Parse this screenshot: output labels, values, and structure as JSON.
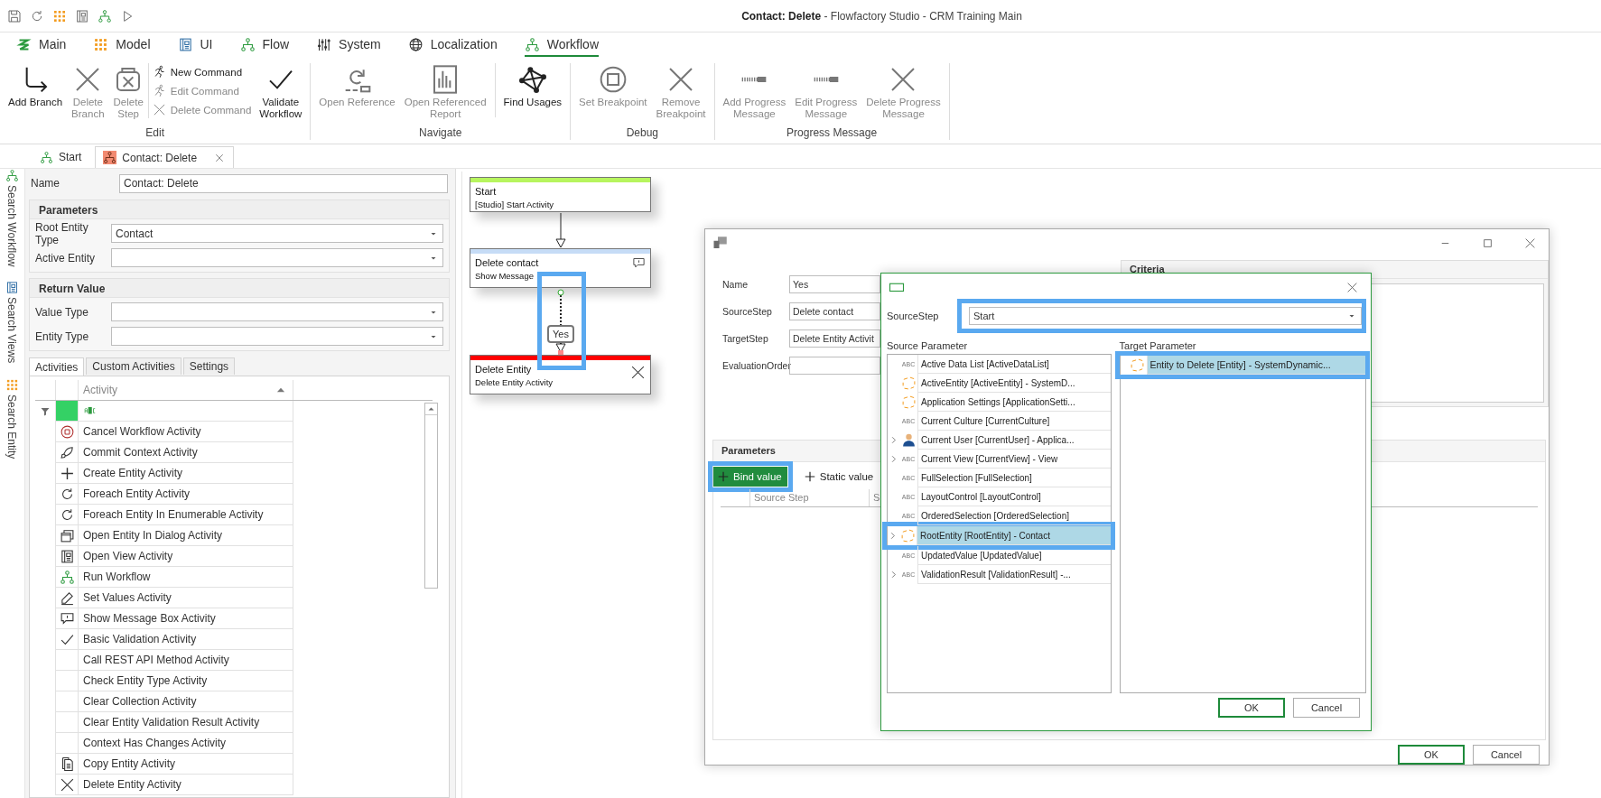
{
  "window": {
    "title": "**Contact: Delete**  - Flowfactory Studio - CRM Training Main"
  },
  "menu_tabs": [
    {
      "label": "Main",
      "selected": false
    },
    {
      "label": "Model",
      "selected": false
    },
    {
      "label": "UI",
      "selected": false
    },
    {
      "label": "Flow",
      "selected": false
    },
    {
      "label": "System",
      "selected": false
    },
    {
      "label": "Localization",
      "selected": false
    },
    {
      "label": "Workflow",
      "selected": true
    }
  ],
  "ribbon": [
    {
      "label": "Edit",
      "buttons": [
        {
          "kind": "large",
          "label": "Add Branch",
          "disabled": false
        },
        {
          "kind": "large",
          "label": "Delete\nBranch",
          "disabled": true
        },
        {
          "kind": "large",
          "label": "Delete\nStep",
          "disabled": true
        },
        {
          "kind": "stack",
          "items": [
            {
              "label": "New Command",
              "disabled": false
            },
            {
              "label": "Edit Command",
              "disabled": true
            },
            {
              "label": "Delete Command",
              "disabled": true
            }
          ]
        },
        {
          "kind": "large",
          "label": "Validate\nWorkflow",
          "disabled": false
        }
      ]
    },
    {
      "label": "Navigate",
      "buttons": [
        {
          "kind": "large",
          "label": "Open Reference",
          "disabled": true
        },
        {
          "kind": "large",
          "label": "Open Referenced\nReport",
          "disabled": true
        },
        {
          "kind": "separator"
        },
        {
          "kind": "large",
          "label": "Find Usages",
          "disabled": false
        }
      ]
    },
    {
      "label": "Debug",
      "buttons": [
        {
          "kind": "large",
          "label": "Set Breakpoint",
          "disabled": true
        },
        {
          "kind": "large",
          "label": "Remove\nBreakpoint",
          "disabled": true
        }
      ]
    },
    {
      "label": "Progress Message",
      "buttons": [
        {
          "kind": "large",
          "label": "Add Progress\nMessage",
          "disabled": true
        },
        {
          "kind": "large",
          "label": "Edit Progress\nMessage",
          "disabled": true
        },
        {
          "kind": "large",
          "label": "Delete Progress\nMessage",
          "disabled": true
        }
      ]
    }
  ],
  "doc_tabs": [
    {
      "label": "Start",
      "selected": false,
      "closable": false
    },
    {
      "label": "Contact: Delete",
      "selected": true,
      "closable": true
    }
  ],
  "sidebar": {
    "items": [
      {
        "label": "Search Workflow"
      },
      {
        "label": "Search Views"
      },
      {
        "label": "Search Entity"
      }
    ]
  },
  "properties": {
    "name": {
      "label": "Name",
      "value": "Contact: Delete"
    },
    "groups": [
      {
        "title": "Parameters",
        "fields": [
          {
            "label": "Root Entity Type",
            "value": "Contact"
          },
          {
            "label": "Active Entity"
          }
        ]
      },
      {
        "title": "Return Value",
        "fields": [
          {
            "label": "Value Type"
          },
          {
            "label": "Entity Type"
          }
        ]
      }
    ]
  },
  "activity_tabs": [
    {
      "label": "Activities",
      "selected": true
    },
    {
      "label": "Custom Activities",
      "selected": false
    },
    {
      "label": "Settings",
      "selected": false
    }
  ],
  "activities": {
    "columns": [
      "Activity"
    ],
    "rows": [
      {
        "name": "Cancel Workflow Activity",
        "kind": "cancel"
      },
      {
        "name": "Commit Context Activity",
        "kind": "commit"
      },
      {
        "name": "Create Entity Activity",
        "kind": "create"
      },
      {
        "name": "Foreach Entity Activity",
        "kind": "loop"
      },
      {
        "name": "Foreach Entity In Enumerable Activity",
        "kind": "loop"
      },
      {
        "name": "Open Entity In Dialog Activity",
        "kind": "dialog"
      },
      {
        "name": "Open View Activity",
        "kind": "view"
      },
      {
        "name": "Run Workflow",
        "kind": "workflow"
      },
      {
        "name": "Set Values Activity",
        "kind": "edit"
      },
      {
        "name": "Show Message Box  Activity",
        "kind": "message"
      },
      {
        "name": "Basic Validation Activity",
        "kind": "check"
      },
      {
        "name": "Call REST API Method Activity",
        "kind": "plain"
      },
      {
        "name": "Check Entity Type Activity",
        "kind": "plain"
      },
      {
        "name": "Clear Collection Activity",
        "kind": "plain"
      },
      {
        "name": "Clear Entity Validation Result Activity",
        "kind": "plain"
      },
      {
        "name": "Context Has Changes Activity",
        "kind": "plain"
      },
      {
        "name": "Copy Entity Activity",
        "kind": "copy"
      },
      {
        "name": "Delete Entity Activity",
        "kind": "delete"
      }
    ]
  },
  "canvas": {
    "nodes": [
      {
        "title": "Start",
        "subtitle": "[Studio] Start Activity",
        "color": "#b7f55e",
        "kind": "start"
      },
      {
        "title": "Delete contact",
        "subtitle": "Show Message",
        "color": "#c6dcf6",
        "kind": "message"
      },
      {
        "title": "Delete Entity",
        "subtitle": "Delete Entity Activity",
        "color": "#ff0000",
        "kind": "delete"
      }
    ],
    "connections": [
      {
        "kind": "solid",
        "highlighted": false
      },
      {
        "kind": "dotted",
        "label": "Yes",
        "highlighted": true
      }
    ]
  },
  "transition_dialog": {
    "fields": [
      {
        "label": "Name",
        "value": "Yes"
      },
      {
        "label": "SourceStep",
        "value": "Delete contact"
      },
      {
        "label": "TargetStep",
        "value": "Delete Entity Activit"
      },
      {
        "label": "EvaluationOrder"
      }
    ],
    "criteria": {
      "title": "Criteria"
    },
    "parameters": {
      "title": "Parameters",
      "actions": [
        {
          "label": "Bind value",
          "kind": "primary",
          "highlighted": true
        },
        {
          "label": "Static value",
          "kind": "plain",
          "highlighted": false
        }
      ],
      "columns": [
        "Source Step",
        "S"
      ]
    },
    "buttons": [
      {
        "label": "OK",
        "default": true
      },
      {
        "label": "Cancel",
        "default": false
      }
    ]
  },
  "bind_dialog": {
    "source_step": {
      "label": "SourceStep",
      "value": "Start",
      "highlighted": true
    },
    "source_parameter": {
      "title": "Source Parameter",
      "items": [
        {
          "label": "Active Data List [ActiveDataList]",
          "kind": "text",
          "tag": "ABC",
          "expandable": false,
          "selected": false,
          "highlighted": false
        },
        {
          "label": "ActiveEntity [ActiveEntity]  -  SystemD...",
          "kind": "entity",
          "expandable": false,
          "selected": false,
          "highlighted": false
        },
        {
          "label": "Application Settings [ApplicationSetti...",
          "kind": "entity",
          "expandable": false,
          "selected": false,
          "highlighted": false
        },
        {
          "label": "Current Culture [CurrentCulture]",
          "kind": "text",
          "tag": "ABC",
          "expandable": false,
          "selected": false,
          "highlighted": false
        },
        {
          "label": "Current User [CurrentUser]  -  Applica...",
          "kind": "user",
          "expandable": true,
          "selected": false,
          "highlighted": false
        },
        {
          "label": "Current View [CurrentView]  -  View",
          "kind": "text",
          "tag": "ABC",
          "expandable": true,
          "selected": false,
          "highlighted": false
        },
        {
          "label": "FullSelection [FullSelection]",
          "kind": "text",
          "tag": "ABC",
          "expandable": false,
          "selected": false,
          "highlighted": false
        },
        {
          "label": "LayoutControl [LayoutControl]",
          "kind": "text",
          "tag": "ABC",
          "expandable": false,
          "selected": false,
          "highlighted": false
        },
        {
          "label": "OrderedSelection [OrderedSelection]",
          "kind": "text",
          "tag": "ABC",
          "expandable": false,
          "selected": false,
          "highlighted": false
        },
        {
          "label": "RootEntity [RootEntity]  -  Contact",
          "kind": "entity",
          "expandable": true,
          "selected": true,
          "highlighted": true
        },
        {
          "label": "UpdatedValue [UpdatedValue]",
          "kind": "text",
          "tag": "ABC",
          "expandable": false,
          "selected": false,
          "highlighted": false
        },
        {
          "label": "ValidationResult [ValidationResult]  -...",
          "kind": "text",
          "tag": "ABC",
          "expandable": true,
          "selected": false,
          "highlighted": false
        }
      ]
    },
    "target_parameter": {
      "title": "Target Parameter",
      "items": [
        {
          "label": "Entity to Delete [Entity]  -  SystemDynamic...",
          "kind": "entity",
          "expandable": false,
          "selected": true,
          "highlighted": true
        }
      ]
    },
    "buttons": [
      {
        "label": "OK",
        "default": true
      },
      {
        "label": "Cancel",
        "default": false
      }
    ]
  }
}
